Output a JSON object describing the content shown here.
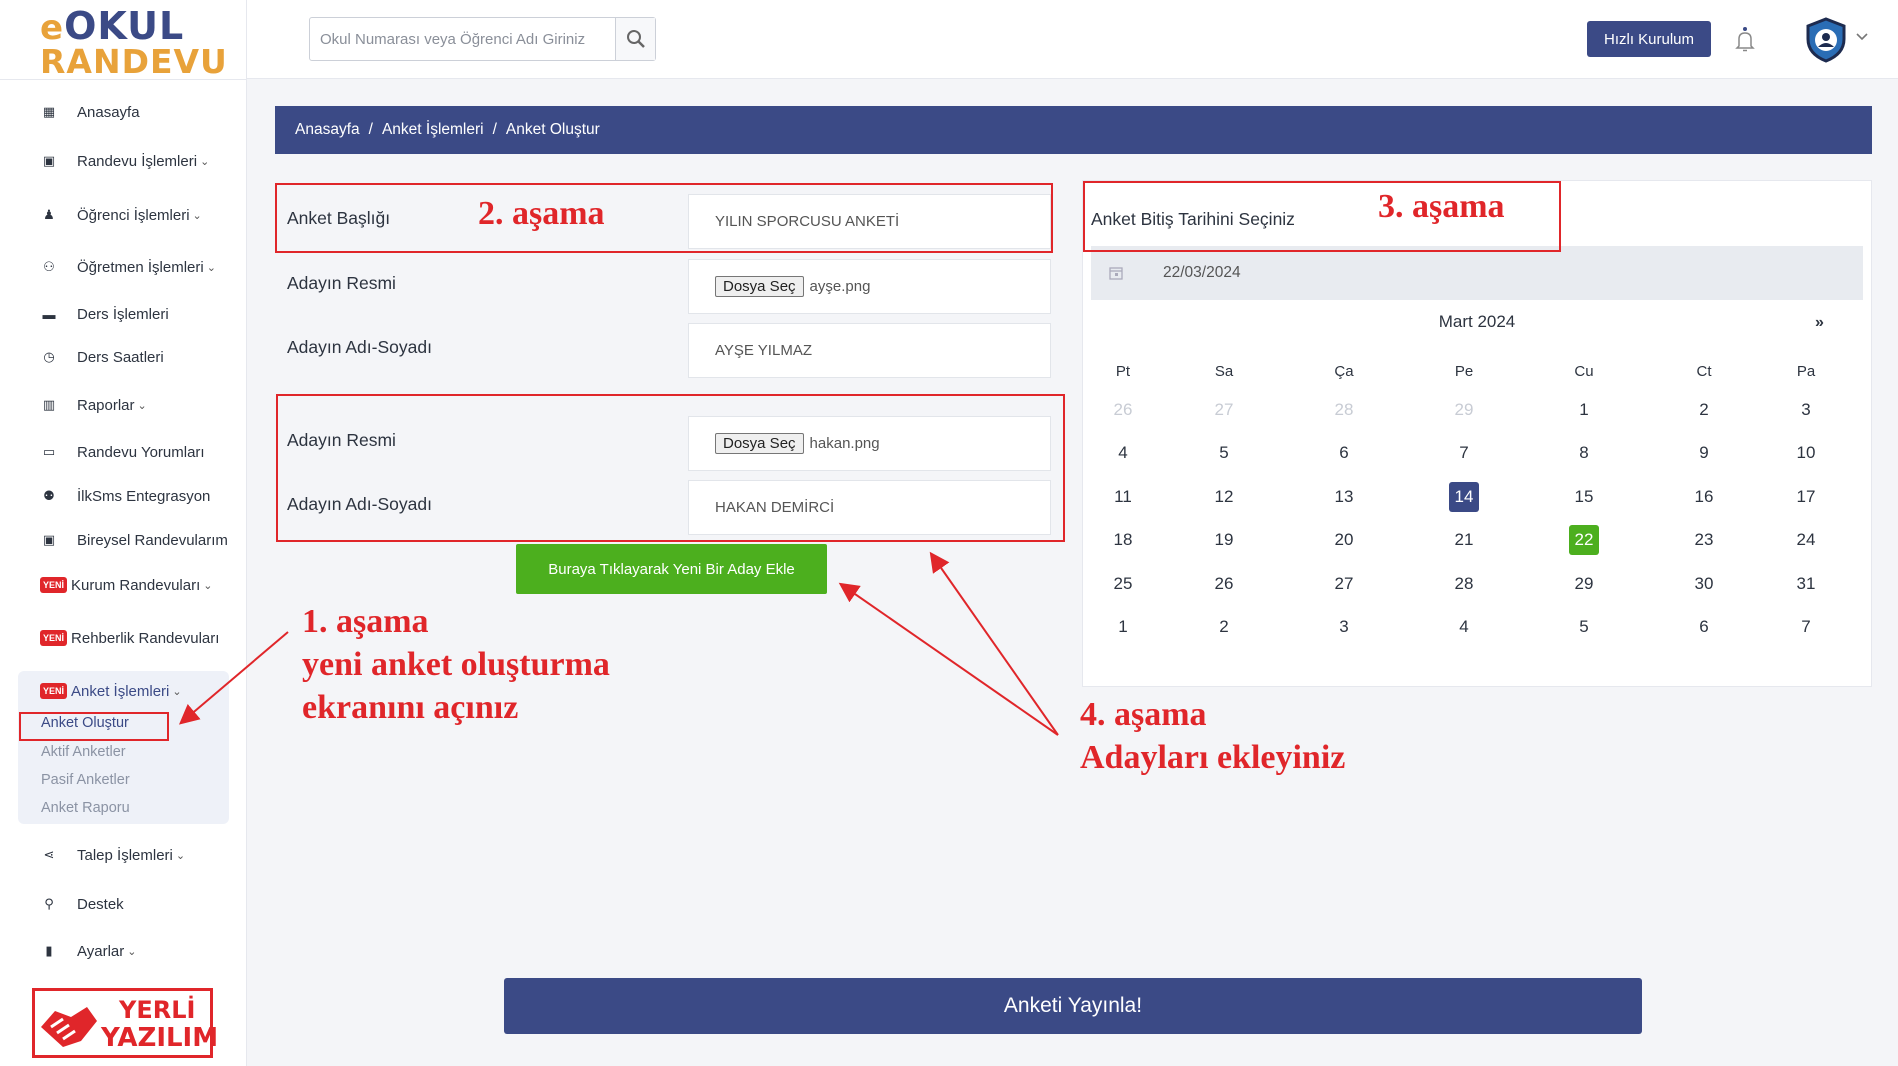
{
  "logo": {
    "line1_e": "e",
    "line1_rest": "OKUL",
    "line2": "RANDEVU"
  },
  "sidebar": {
    "items": [
      {
        "label": "Anasayfa",
        "icon": "grid-icon",
        "chevron": false,
        "yeni": false
      },
      {
        "label": "Randevu İşlemleri",
        "icon": "calendar-icon",
        "chevron": true,
        "yeni": false
      },
      {
        "label": "Öğrenci İşlemleri",
        "icon": "student-icon",
        "chevron": true,
        "yeni": false
      },
      {
        "label": "Öğretmen İşlemleri",
        "icon": "users-icon",
        "chevron": true,
        "yeni": false
      },
      {
        "label": "Ders İşlemleri",
        "icon": "folder-icon",
        "chevron": false,
        "yeni": false
      },
      {
        "label": "Ders Saatleri",
        "icon": "clock-icon",
        "chevron": false,
        "yeni": false
      },
      {
        "label": "Raporlar",
        "icon": "bar-chart-icon",
        "chevron": true,
        "yeni": false
      },
      {
        "label": "Randevu Yorumları",
        "icon": "comment-icon",
        "chevron": false,
        "yeni": false
      },
      {
        "label": "İlkSms Entegrasyon",
        "icon": "sms-icon",
        "chevron": false,
        "yeni": false
      },
      {
        "label": "Bireysel Randevularım",
        "icon": "calendar-check-icon",
        "chevron": false,
        "yeni": false
      },
      {
        "label": "Kurum Randevuları",
        "icon": "",
        "chevron": true,
        "yeni": true
      },
      {
        "label": "Rehberlik Randevuları",
        "icon": "",
        "chevron": false,
        "yeni": true
      },
      {
        "label": "Anket İşlemleri",
        "icon": "",
        "chevron": true,
        "yeni": true
      },
      {
        "label": "Talep İşlemleri",
        "icon": "share-icon",
        "chevron": true,
        "yeni": false
      },
      {
        "label": "Destek",
        "icon": "support-icon",
        "chevron": false,
        "yeni": false
      },
      {
        "label": "Ayarlar",
        "icon": "lock-icon",
        "chevron": true,
        "yeni": false
      }
    ],
    "yeni_badge": "YENİ",
    "sub_items": [
      "Anket Oluştur",
      "Aktif Anketler",
      "Pasif Anketler",
      "Anket Raporu"
    ],
    "yerli": {
      "line1": "YERLİ",
      "line2": "YAZILIM"
    }
  },
  "topbar": {
    "search_placeholder": "Okul Numarası veya Öğrenci Adı Giriniz",
    "quick_setup": "Hızlı Kurulum"
  },
  "breadcrumb": [
    "Anasayfa",
    "/",
    "Anket İşlemleri",
    "/",
    "Anket Oluştur"
  ],
  "form": {
    "title_label": "Anket Başlığı",
    "title_value": "YILIN SPORCUSU ANKETİ",
    "file_button": "Dosya Seç",
    "candidates": [
      {
        "photo_label": "Adayın Resmi",
        "file": "ayşe.png",
        "name_label": "Adayın Adı-Soyadı",
        "name": "AYŞE YILMAZ"
      },
      {
        "photo_label": "Adayın Resmi",
        "file": "hakan.png",
        "name_label": "Adayın Adı-Soyadı",
        "name": "HAKAN DEMİRCİ"
      }
    ],
    "add_button": "Buraya Tıklayarak Yeni Bir Aday Ekle"
  },
  "date": {
    "label": "Anket Bitiş Tarihini Seçiniz",
    "value": "22/03/2024",
    "month": "Mart 2024",
    "next": "»",
    "weekdays": [
      "Pt",
      "Sa",
      "Ça",
      "Pe",
      "Cu",
      "Ct",
      "Pa"
    ],
    "weeks": [
      [
        "26",
        "27",
        "28",
        "29",
        "1",
        "2",
        "3"
      ],
      [
        "4",
        "5",
        "6",
        "7",
        "8",
        "9",
        "10"
      ],
      [
        "11",
        "12",
        "13",
        "14",
        "15",
        "16",
        "17"
      ],
      [
        "18",
        "19",
        "20",
        "21",
        "22",
        "23",
        "24"
      ],
      [
        "25",
        "26",
        "27",
        "28",
        "29",
        "30",
        "31"
      ],
      [
        "1",
        "2",
        "3",
        "4",
        "5",
        "6",
        "7"
      ]
    ],
    "muted_first_row_count": 4,
    "today": "14",
    "selected": "22"
  },
  "publish_button": "Anketi Yayınla!",
  "annotations": {
    "step1": [
      "1. aşama",
      "yeni anket oluşturma",
      "ekranını açınız"
    ],
    "step2": "2. aşama",
    "step3": "3. aşama",
    "step4": [
      "4. aşama",
      "Adayları ekleyiniz"
    ]
  },
  "colors": {
    "brand": "#3b4a86",
    "accent": "#e8a23a",
    "green": "#4caf1e",
    "annotation_red": "#e0262a"
  }
}
